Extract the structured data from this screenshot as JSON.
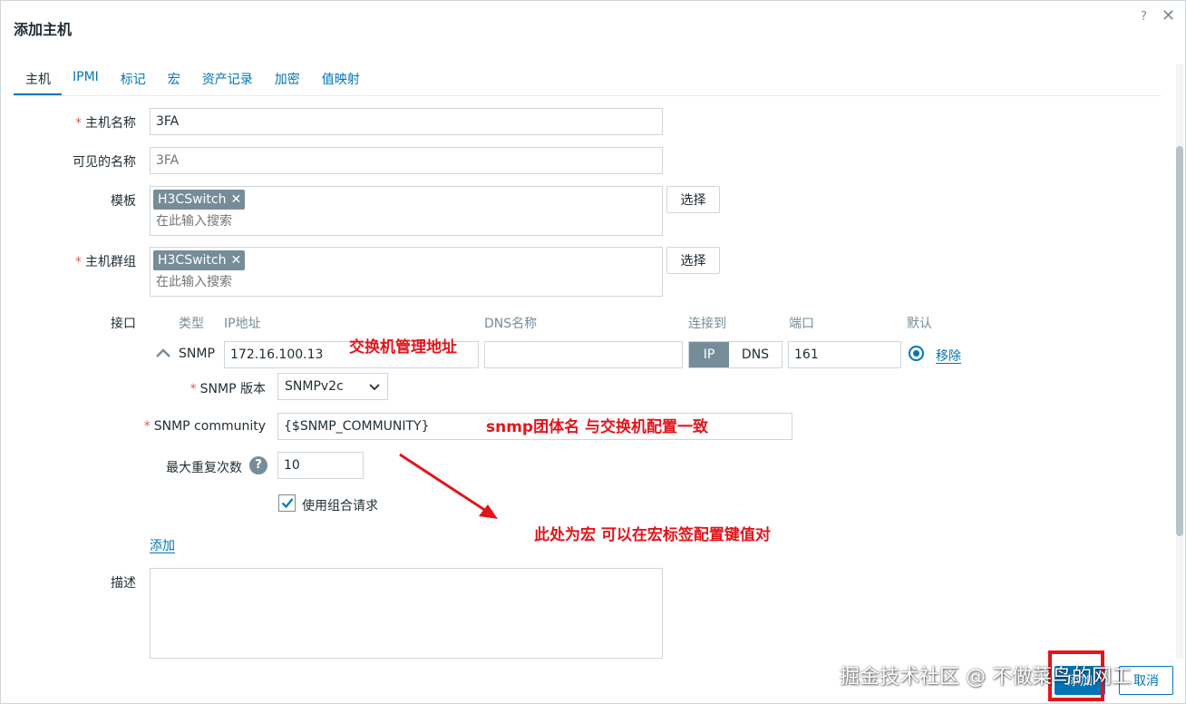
{
  "dialog": {
    "title": "添加主机",
    "help": "?",
    "close": "✕"
  },
  "tabs": [
    "主机",
    "IPMI",
    "标记",
    "宏",
    "资产记录",
    "加密",
    "值映射"
  ],
  "form": {
    "host_name": {
      "label": "主机名称",
      "required": "*",
      "value": "3FA"
    },
    "visible_name": {
      "label": "可见的名称",
      "placeholder": "3FA"
    },
    "templates": {
      "label": "模板",
      "chip": "H3CSwitch",
      "chip_remove": "✕",
      "search_placeholder": "在此输入搜索",
      "select_button": "选择"
    },
    "host_groups": {
      "label": "主机群组",
      "required": "*",
      "chip": "H3CSwitch",
      "chip_remove": "✕",
      "search_placeholder": "在此输入搜索",
      "select_button": "选择"
    },
    "interfaces": {
      "label": "接口",
      "columns": {
        "type": "类型",
        "ip": "IP地址",
        "dns": "DNS名称",
        "connect_to": "连接到",
        "port": "端口",
        "default": "默认"
      },
      "row": {
        "type": "SNMP",
        "ip": "172.16.100.13",
        "dns": "",
        "connect_ip": "IP",
        "connect_dns": "DNS",
        "port": "161",
        "remove": "移除"
      },
      "snmp_version": {
        "label": "SNMP 版本",
        "required": "*",
        "value": "SNMPv2c"
      },
      "snmp_community": {
        "label": "SNMP community",
        "required": "*",
        "value": "{$SNMP_COMMUNITY}"
      },
      "max_repetitions": {
        "label": "最大重复次数",
        "value": "10",
        "help": "?"
      },
      "bulk": {
        "label": "使用组合请求",
        "checked": true
      },
      "add_link": "添加"
    },
    "description": {
      "label": "描述",
      "value": ""
    }
  },
  "annotations": {
    "ip_note": "交换机管理地址",
    "community_note": "snmp团体名 与交换机配置一致",
    "macro_note": "此处为宏 可以在宏标签配置键值对"
  },
  "footer": {
    "add": "添加",
    "cancel": "取消"
  },
  "watermark": "掘金技术社区 @ 不做菜鸟的网工",
  "colors": {
    "accent": "#0275b8",
    "chip": "#768d99",
    "annotation": "#e0161b",
    "required": "#e45959"
  }
}
